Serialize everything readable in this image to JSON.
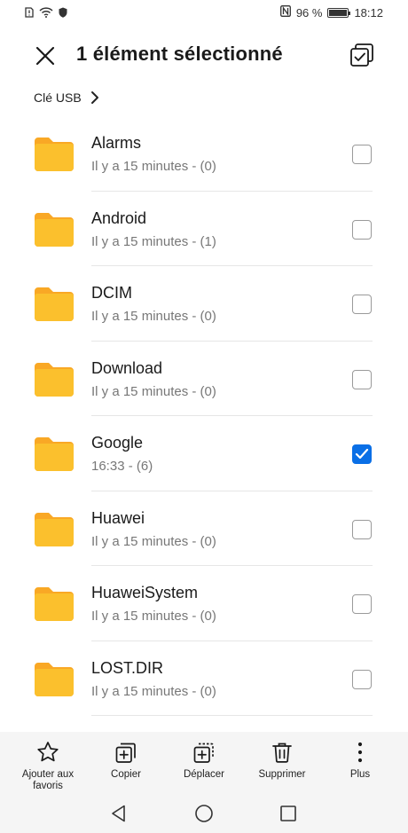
{
  "status": {
    "battery_text": "96 %",
    "battery_level": 0.96,
    "time": "18:12"
  },
  "header": {
    "title": "1 élément sélectionné"
  },
  "breadcrumb": {
    "label": "Clé USB"
  },
  "colors": {
    "folder": "#FBC02D",
    "folder_tab": "#F9A825",
    "accent": "#0A6FE6"
  },
  "items": [
    {
      "name": "Alarms",
      "meta": "Il y a 15 minutes - (0)",
      "checked": false
    },
    {
      "name": "Android",
      "meta": "Il y a 15 minutes - (1)",
      "checked": false
    },
    {
      "name": "DCIM",
      "meta": "Il y a 15 minutes - (0)",
      "checked": false
    },
    {
      "name": "Download",
      "meta": "Il y a 15 minutes - (0)",
      "checked": false
    },
    {
      "name": "Google",
      "meta": "16:33 - (6)",
      "checked": true
    },
    {
      "name": "Huawei",
      "meta": "Il y a 15 minutes - (0)",
      "checked": false
    },
    {
      "name": "HuaweiSystem",
      "meta": "Il y a 15 minutes - (0)",
      "checked": false
    },
    {
      "name": "LOST.DIR",
      "meta": "Il y a 15 minutes - (0)",
      "checked": false
    }
  ],
  "toolbar": {
    "favorite_label_line1": "Ajouter aux",
    "favorite_label_line2": "favoris",
    "copy_label": "Copier",
    "move_label": "Déplacer",
    "delete_label": "Supprimer",
    "more_label": "Plus"
  }
}
